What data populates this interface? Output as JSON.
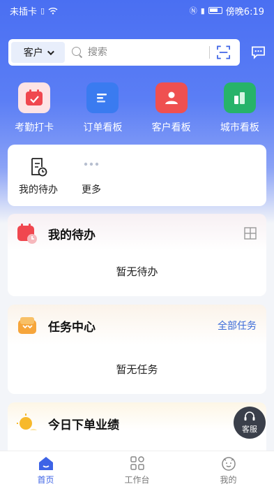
{
  "status_bar": {
    "carrier": "未插卡",
    "time": "傍晚6:19"
  },
  "search": {
    "category": "客户",
    "placeholder": "搜索"
  },
  "quick_actions": [
    {
      "label": "考勤打卡",
      "icon": "calendar-check-icon",
      "color": "#f0474f"
    },
    {
      "label": "订单看板",
      "icon": "order-board-icon",
      "color": "#3a7bf0"
    },
    {
      "label": "客户看板",
      "icon": "customer-board-icon",
      "color": "#ef5050"
    },
    {
      "label": "城市看板",
      "icon": "city-board-icon",
      "color": "#27b36a"
    }
  ],
  "shortcuts": [
    {
      "label": "我的待办",
      "icon": "todo-doc-icon"
    },
    {
      "label": "更多",
      "icon": "more-dots-icon"
    }
  ],
  "sections": {
    "todo": {
      "title": "我的待办",
      "empty": "暂无待办"
    },
    "tasks": {
      "title": "任务中心",
      "link": "全部任务",
      "empty": "暂无任务"
    },
    "performance": {
      "title": "今日下单业绩"
    }
  },
  "customer_service": {
    "label": "客服"
  },
  "bottom_nav": [
    {
      "label": "首页",
      "icon": "home-icon",
      "active": true
    },
    {
      "label": "工作台",
      "icon": "grid-icon",
      "active": false
    },
    {
      "label": "我的",
      "icon": "smiley-icon",
      "active": false
    }
  ],
  "colors": {
    "primary": "#3d63e6",
    "accent_link": "#3a6ad8"
  }
}
